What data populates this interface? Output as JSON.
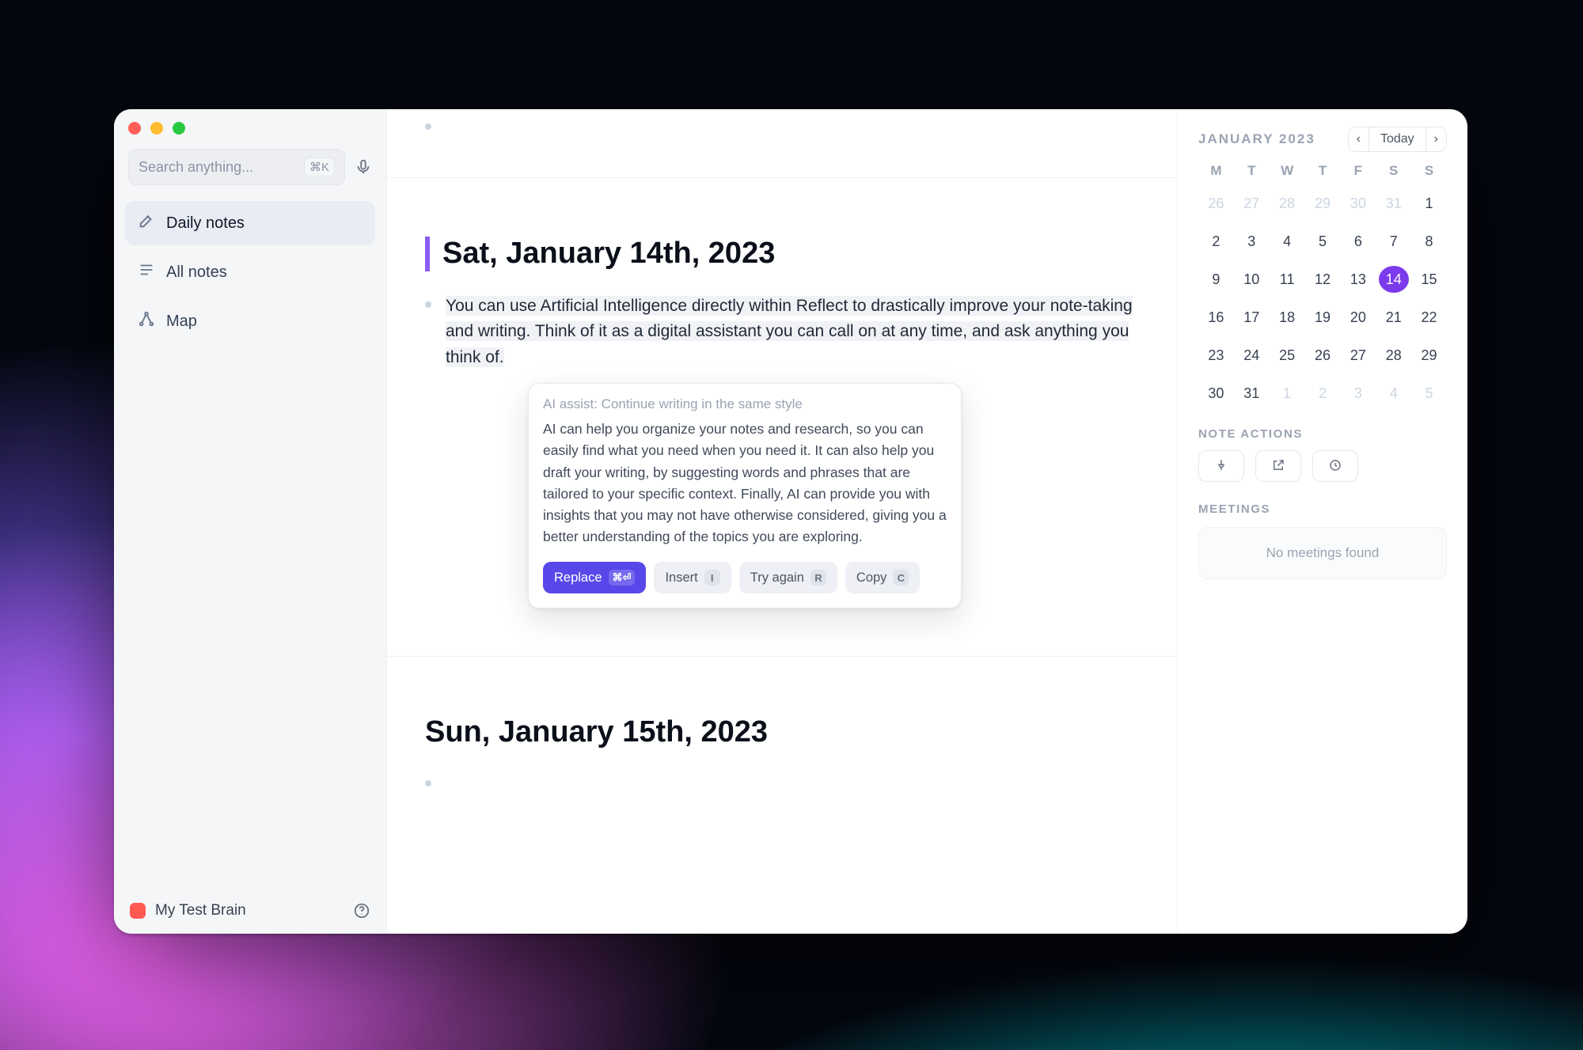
{
  "sidebar": {
    "search_placeholder": "Search anything...",
    "search_shortcut": "⌘K",
    "items": [
      {
        "label": "Daily notes"
      },
      {
        "label": "All notes"
      },
      {
        "label": "Map"
      }
    ],
    "brain_label": "My Test Brain"
  },
  "main": {
    "days": [
      {
        "title": "Sat, January 14th, 2023",
        "highlighted_text": "You can use Artificial Intelligence directly within Reflect to drastically improve your note-taking and writing. Think of it as a digital assistant you can call on at any time, and ask anything you think of."
      },
      {
        "title": "Sun, January 15th, 2023"
      }
    ],
    "ai": {
      "hint": "AI assist: Continue writing in the same style",
      "body": "AI can help you organize your notes and research, so you can easily find what you need when you need it. It can also help you draft your writing, by suggesting words and phrases that are tailored to your specific context. Finally, AI can provide you with insights that you may not have otherwise considered, giving you a better understanding of the topics you are exploring.",
      "buttons": {
        "replace": {
          "label": "Replace",
          "chip": "⌘⏎"
        },
        "insert": {
          "label": "Insert",
          "chip": "I"
        },
        "try_again": {
          "label": "Try again",
          "chip": "R"
        },
        "copy": {
          "label": "Copy",
          "chip": "C"
        }
      }
    }
  },
  "panel": {
    "calendar": {
      "title": "JANUARY 2023",
      "today_label": "Today",
      "dow": [
        "M",
        "T",
        "W",
        "T",
        "F",
        "S",
        "S"
      ],
      "weeks": [
        [
          {
            "n": "26",
            "out": true
          },
          {
            "n": "27",
            "out": true
          },
          {
            "n": "28",
            "out": true
          },
          {
            "n": "29",
            "out": true
          },
          {
            "n": "30",
            "out": true
          },
          {
            "n": "31",
            "out": true
          },
          {
            "n": "1"
          }
        ],
        [
          {
            "n": "2"
          },
          {
            "n": "3"
          },
          {
            "n": "4"
          },
          {
            "n": "5"
          },
          {
            "n": "6"
          },
          {
            "n": "7"
          },
          {
            "n": "8"
          }
        ],
        [
          {
            "n": "9"
          },
          {
            "n": "10"
          },
          {
            "n": "11"
          },
          {
            "n": "12"
          },
          {
            "n": "13"
          },
          {
            "n": "14",
            "sel": true
          },
          {
            "n": "15"
          }
        ],
        [
          {
            "n": "16"
          },
          {
            "n": "17"
          },
          {
            "n": "18"
          },
          {
            "n": "19"
          },
          {
            "n": "20"
          },
          {
            "n": "21"
          },
          {
            "n": "22"
          }
        ],
        [
          {
            "n": "23"
          },
          {
            "n": "24"
          },
          {
            "n": "25"
          },
          {
            "n": "26"
          },
          {
            "n": "27"
          },
          {
            "n": "28"
          },
          {
            "n": "29"
          }
        ],
        [
          {
            "n": "30"
          },
          {
            "n": "31"
          },
          {
            "n": "1",
            "out": true
          },
          {
            "n": "2",
            "out": true
          },
          {
            "n": "3",
            "out": true
          },
          {
            "n": "4",
            "out": true
          },
          {
            "n": "5",
            "out": true
          }
        ]
      ]
    },
    "note_actions_title": "NOTE ACTIONS",
    "meetings_title": "MEETINGS",
    "meetings_empty": "No meetings found"
  }
}
